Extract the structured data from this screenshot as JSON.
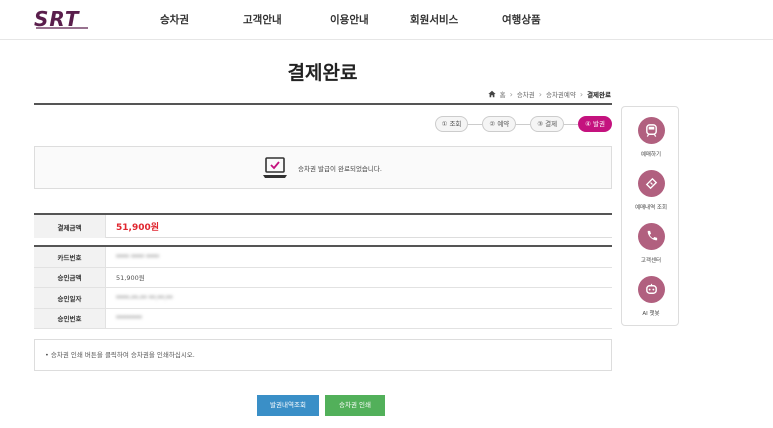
{
  "header": {
    "logo": "SRT",
    "nav": [
      "승차권",
      "고객안내",
      "이용안내",
      "회원서비스",
      "여행상품"
    ]
  },
  "page": {
    "title": "결제완료",
    "breadcrumb": [
      "홈",
      "승차권",
      "승차권예약",
      "결제완료"
    ]
  },
  "steps": [
    "① 조회",
    "② 예약",
    "③ 결제",
    "④ 발권"
  ],
  "notice": {
    "message": "승차권 발급이 완료되었습니다."
  },
  "amount": {
    "label": "결제금액",
    "value": "51,900원"
  },
  "details": [
    {
      "label": "카드번호",
      "value": "**** **** ****"
    },
    {
      "label": "승인금액",
      "value": "51,900원"
    },
    {
      "label": "승인일자",
      "value": "****-**-** **:**:**"
    },
    {
      "label": "승인번호",
      "value": "********"
    }
  ],
  "info": {
    "text": "• 승차권 인쇄 버튼을 클릭하여 승차권을 인쇄하십시오."
  },
  "buttons": {
    "history": "발권내역조회",
    "print": "승차권 인쇄"
  },
  "side_menu": [
    "예매하기",
    "예매내역 조회",
    "고객센터",
    "AI 챗봇"
  ],
  "colors": {
    "accent": "#c4127e",
    "side_icon": "#b1607f",
    "amount": "#e0262f",
    "btn_blue": "#3a8fc7",
    "btn_green": "#52b05a"
  }
}
